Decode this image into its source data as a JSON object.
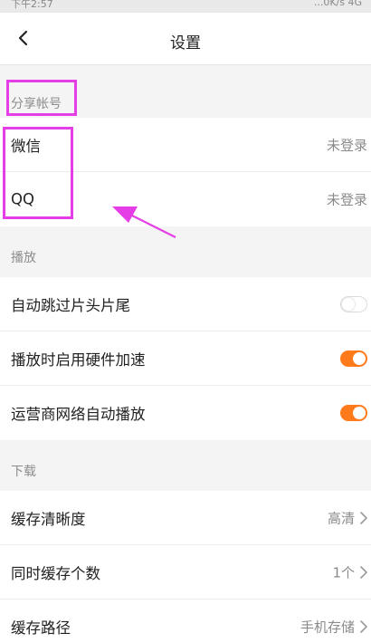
{
  "status_bar": {
    "left": "下午2:57",
    "right": "...0K/s 4G"
  },
  "nav": {
    "title": "设置"
  },
  "sections": [
    {
      "header": "分享帐号",
      "rows": [
        {
          "label": "微信",
          "value": "未登录"
        },
        {
          "label": "QQ",
          "value": "未登录"
        }
      ]
    },
    {
      "header": "播放",
      "rows": [
        {
          "label": "自动跳过片头片尾",
          "toggle": false
        },
        {
          "label": "播放时启用硬件加速",
          "toggle": true
        },
        {
          "label": "运营商网络自动播放",
          "toggle": true
        }
      ]
    },
    {
      "header": "下载",
      "rows": [
        {
          "label": "缓存清晰度",
          "value": "高清"
        },
        {
          "label": "同时缓存个数",
          "value": "1个"
        },
        {
          "label": "缓存路径",
          "value": "手机存储"
        }
      ]
    }
  ],
  "colors": {
    "accent": "#ff7a1a",
    "annotation": "#e63ee6"
  }
}
